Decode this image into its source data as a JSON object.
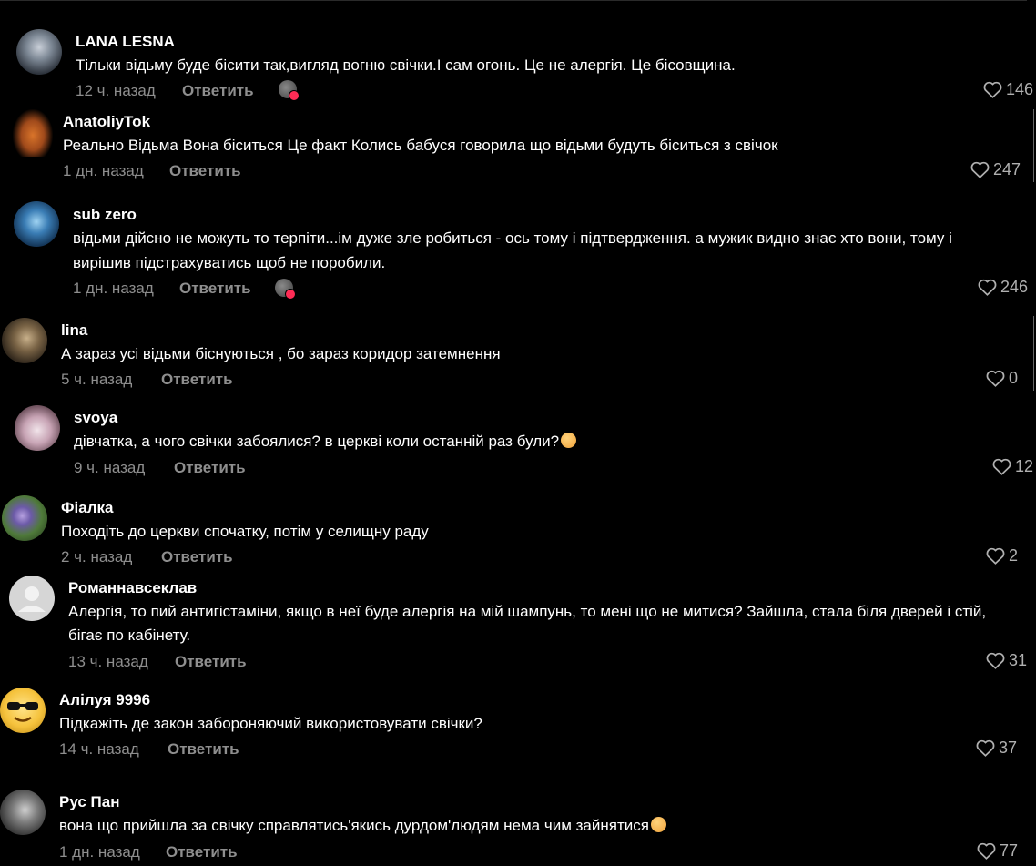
{
  "reply_label": "Ответить",
  "comments": [
    {
      "author": "LANA LESNA",
      "lines": [
        "Тільки відьму буде бісити так,вигляд вогню свічки.І сам огонь. Це не алергія. Це бісовщина."
      ],
      "time": "12 ч. назад",
      "likes": "146"
    },
    {
      "author": "AnatoliyTok",
      "lines": [
        "Реально Відьма Вона біситься Це факт Колись бабуся говорила що відьми будуть біситься з свічок"
      ],
      "time": "1 дн. назад",
      "likes": "247"
    },
    {
      "author": "sub zero",
      "lines": [
        "відьми дійсно не можуть то терпіти...ім дуже зле робиться - ось тому і підтвердження. а мужик видно знає хто вони, тому і",
        "вирішив підстрахуватись щоб не поробили."
      ],
      "time": "1 дн. назад",
      "likes": "246"
    },
    {
      "author": "lina",
      "lines": [
        "А зараз усі відьми біснуються , бо зараз коридор затемнення"
      ],
      "time": "5 ч. назад",
      "likes": "0"
    },
    {
      "author": "svoya",
      "lines": [
        "дівчатка, а чого свічки забоялися? в церкві коли останній раз були?"
      ],
      "time": "9 ч. назад",
      "likes": "12"
    },
    {
      "author": "Фіалка",
      "lines": [
        "Походіть до церкви спочатку, потім у селищну раду"
      ],
      "time": "2 ч. назад",
      "likes": "2"
    },
    {
      "author": "Романнавсеклав",
      "lines": [
        "Алергія, то пий антигістаміни, якщо в неї буде алергія на мій шампунь, то мені що не митися? Зайшла, стала біля дверей і стій,",
        "бігає по кабінету."
      ],
      "time": "13 ч. назад",
      "likes": "31"
    },
    {
      "author": "Алілуя 9996",
      "lines": [
        "Підкажіть де закон забороняючий використовувати свічки?"
      ],
      "time": "14 ч. назад",
      "likes": "37"
    },
    {
      "author": "Рус Пан",
      "lines": [
        "вона що прийшла за свічку справлятись'якись дурдом'людям нема чим зайнятися"
      ],
      "time": "1 дн. назад",
      "likes": "77"
    }
  ],
  "colors": {
    "background": "#000000",
    "muted": "#8e8e8e",
    "text": "#ffffff",
    "badge": "#fe2c55"
  }
}
